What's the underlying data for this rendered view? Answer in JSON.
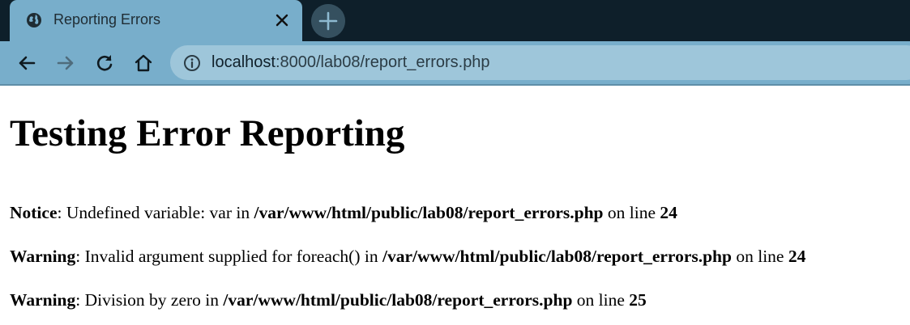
{
  "browser": {
    "tab_title": "Reporting Errors",
    "url_host": "localhost",
    "url_rest": ":8000/lab08/report_errors.php",
    "colors": {
      "tabbar": "#0e1f2a",
      "chrome": "#78aecb",
      "omnibox": "#9ec6da"
    }
  },
  "page": {
    "heading": "Testing Error Reporting",
    "errors": [
      {
        "level": "Notice",
        "message": ": Undefined variable: var in ",
        "file": "/var/www/html/public/lab08/report_errors.php",
        "on_line": " on line ",
        "line": "24"
      },
      {
        "level": "Warning",
        "message": ": Invalid argument supplied for foreach() in ",
        "file": "/var/www/html/public/lab08/report_errors.php",
        "on_line": " on line ",
        "line": "24"
      },
      {
        "level": "Warning",
        "message": ": Division by zero in ",
        "file": "/var/www/html/public/lab08/report_errors.php",
        "on_line": " on line ",
        "line": "25"
      }
    ]
  }
}
